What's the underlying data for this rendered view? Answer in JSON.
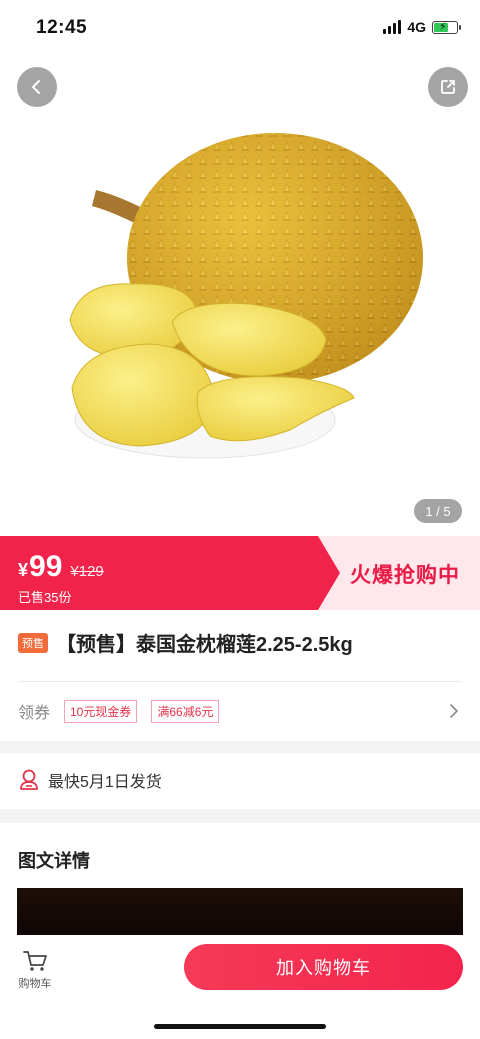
{
  "status_bar": {
    "time": "12:45",
    "network": "4G"
  },
  "hero": {
    "image_name": "durian-product-photo",
    "pager": "1 / 5"
  },
  "price": {
    "currency": "¥",
    "current": "99",
    "original": "¥129",
    "sold": "已售35份",
    "flash_label": "火爆抢购中",
    "accent_color": "#f2234b"
  },
  "product": {
    "presale_tag": "预售",
    "title": "【预售】泰国金枕榴莲2.25-2.5kg"
  },
  "coupons": {
    "label": "领券",
    "items": [
      "10元现金券",
      "满66减6元"
    ]
  },
  "shipping": {
    "text": "最快5月1日发货"
  },
  "detail": {
    "title": "图文详情"
  },
  "bottom": {
    "cart_label": "购物车",
    "add_to_cart": "加入购物车"
  },
  "icons": [
    "back-icon",
    "share-icon",
    "shipping-icon",
    "chevron-right-icon",
    "cart-icon"
  ]
}
